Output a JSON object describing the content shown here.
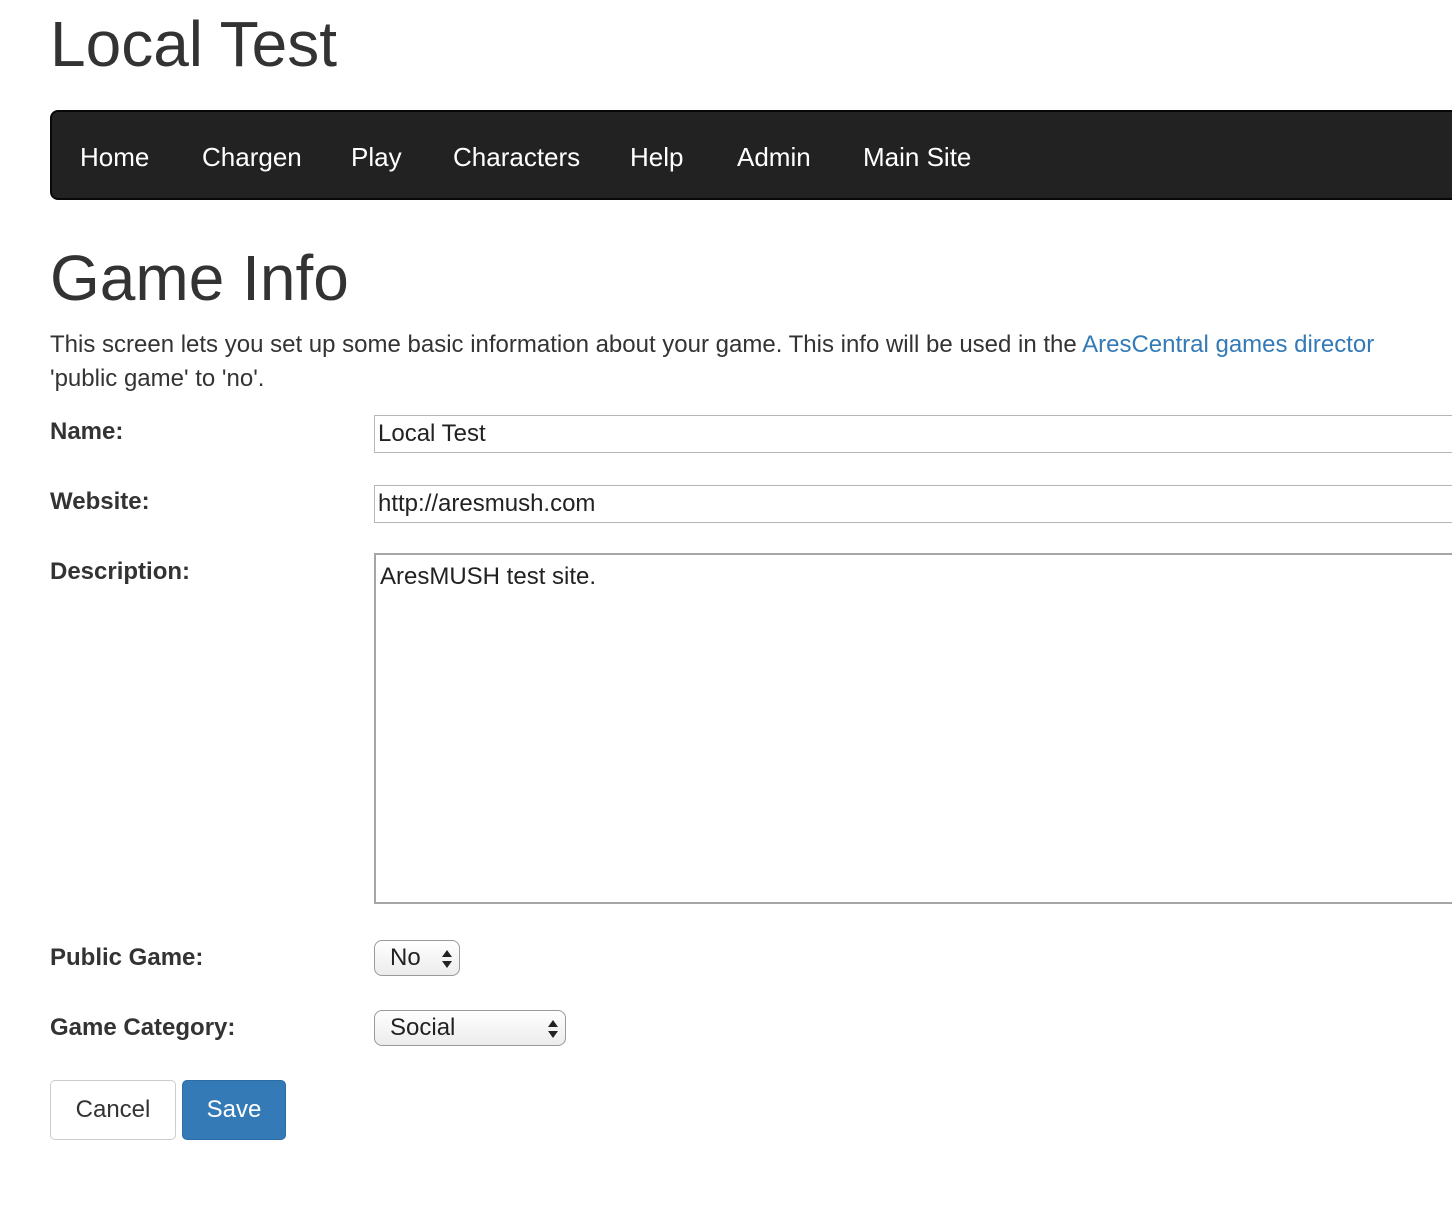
{
  "site": {
    "title": "Local Test"
  },
  "nav": {
    "items": [
      {
        "label": "Home"
      },
      {
        "label": "Chargen"
      },
      {
        "label": "Play"
      },
      {
        "label": "Characters"
      },
      {
        "label": "Help"
      },
      {
        "label": "Admin"
      },
      {
        "label": "Main Site"
      }
    ]
  },
  "page": {
    "heading": "Game Info",
    "intro_before_link": "This screen lets you set up some basic information about your game.  This info will be used in the ",
    "intro_link": "AresCentral games director",
    "intro_line2": "'public game' to 'no'."
  },
  "form": {
    "name": {
      "label": "Name:",
      "value": "Local Test"
    },
    "website": {
      "label": "Website:",
      "value": "http://aresmush.com"
    },
    "description": {
      "label": "Description:",
      "value": "AresMUSH test site."
    },
    "public_game": {
      "label": "Public Game:",
      "value": "No"
    },
    "category": {
      "label": "Game Category:",
      "value": "Social"
    }
  },
  "buttons": {
    "cancel": "Cancel",
    "save": "Save"
  },
  "colors": {
    "navbar_bg": "#222222",
    "link": "#337ab7",
    "primary_button": "#337ab7"
  }
}
